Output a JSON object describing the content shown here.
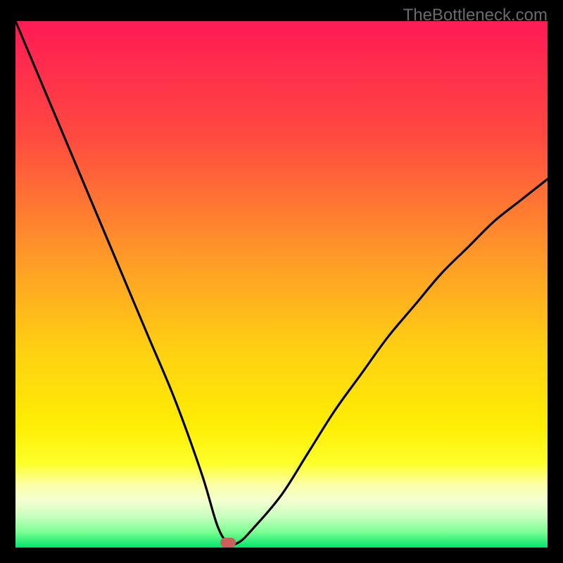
{
  "watermark": "TheBottleneck.com",
  "colors": {
    "bg": "#000000",
    "grad_top": "#ff1a55",
    "grad_mid_high": "#ff6138",
    "grad_mid": "#ffb221",
    "grad_mid_low": "#ffe40f",
    "grad_low1": "#faff4a",
    "grad_low2": "#e7ffb0",
    "grad_low3": "#9eff9e",
    "grad_bottom": "#00e56a",
    "curve": "#000000",
    "marker": "#cb5f5a",
    "watermark": "#6a6a6a"
  },
  "chart_data": {
    "type": "line",
    "title": "",
    "xlabel": "",
    "ylabel": "",
    "xlim": [
      0,
      100
    ],
    "ylim": [
      0,
      100
    ],
    "note": "V-shaped bottleneck curve with a minimum near x≈40; background gradient encodes severity from red (100) down to green (0).",
    "series": [
      {
        "name": "bottleneck-curve",
        "x": [
          0,
          5,
          10,
          15,
          20,
          25,
          30,
          35,
          38,
          40,
          42,
          45,
          50,
          55,
          60,
          65,
          70,
          75,
          80,
          85,
          90,
          95,
          100
        ],
        "y": [
          100,
          88,
          76,
          64,
          52,
          40,
          28,
          14,
          4,
          1,
          1,
          4,
          10,
          18,
          26,
          33,
          40,
          46,
          52,
          57,
          62,
          66,
          70
        ]
      }
    ],
    "marker": {
      "x": 40,
      "y": 1
    },
    "gradient_stops": [
      {
        "pos": 0,
        "value": 100
      },
      {
        "pos": 50,
        "value": 50
      },
      {
        "pos": 80,
        "value": 20
      },
      {
        "pos": 100,
        "value": 0
      }
    ]
  }
}
